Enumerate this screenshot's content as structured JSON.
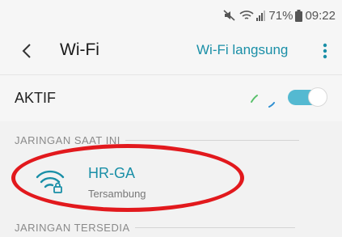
{
  "status_bar": {
    "battery_text": "71%",
    "time": "09:22",
    "icons": [
      "mute-icon",
      "wifi-signal-icon",
      "cell-signal-icon",
      "battery-icon"
    ]
  },
  "header": {
    "title": "Wi-Fi",
    "wifi_direct_label": "Wi-Fi langsung",
    "icons": [
      "back-icon",
      "more-vert-icon"
    ]
  },
  "toggle": {
    "label": "AKTIF",
    "state": "on",
    "color": "#54b9d1"
  },
  "current_network": {
    "header": "JARINGAN SAAT INI",
    "name": "HR-GA",
    "status": "Tersambung",
    "icon": "wifi-lock-icon"
  },
  "available_networks": {
    "header": "JARINGAN TERSEDIA"
  },
  "colors": {
    "accent": "#1a8fa7",
    "annotation": "#e2191d"
  }
}
